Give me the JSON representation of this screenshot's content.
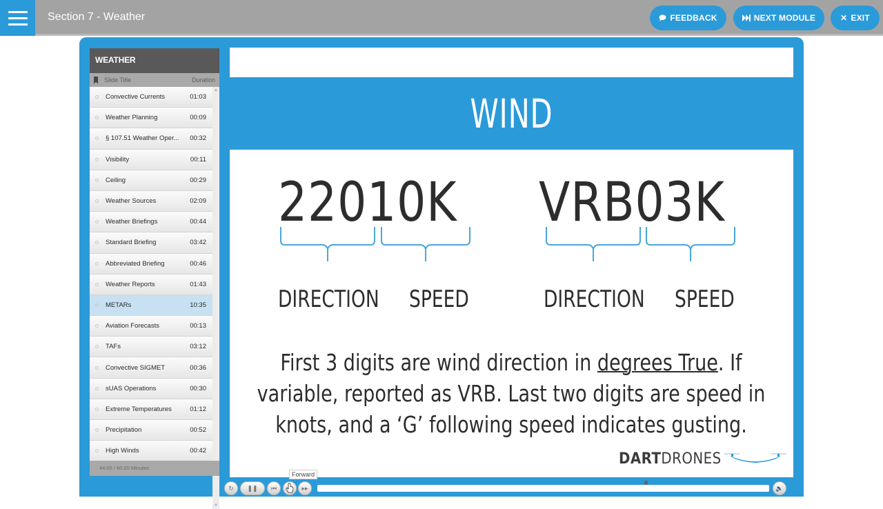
{
  "topbar": {
    "title": "Section 7 - Weather",
    "progress_fraction": 0.04,
    "buttons": {
      "feedback": {
        "icon": "speech-bubble-icon",
        "label": "FEEDBACK"
      },
      "next_module": {
        "icon": "skip-forward-icon",
        "label": "NEXT MODULE"
      },
      "exit": {
        "icon": "close-icon",
        "label": "EXIT"
      }
    },
    "accent_color": "#2b9ad9"
  },
  "outline": {
    "heading": "WEATHER",
    "col_title": "Slide Title",
    "col_duration": "Duration",
    "items": [
      {
        "title": "Convective Currents",
        "duration": "01:03"
      },
      {
        "title": "Weather Planning",
        "duration": "00:09"
      },
      {
        "title": "§ 107.51 Weather Oper...",
        "duration": "00:32"
      },
      {
        "title": "Visibility",
        "duration": "00:11"
      },
      {
        "title": "Ceiling",
        "duration": "00:29"
      },
      {
        "title": "Weather Sources",
        "duration": "02:09"
      },
      {
        "title": "Weather Briefings",
        "duration": "00:44"
      },
      {
        "title": "Standard Briefing",
        "duration": "03:42"
      },
      {
        "title": "Abbreviated Briefing",
        "duration": "00:46"
      },
      {
        "title": "Weather Reports",
        "duration": "01:43"
      },
      {
        "title": "METARs",
        "duration": "10:35",
        "active": true
      },
      {
        "title": "Aviation Forecasts",
        "duration": "00:13"
      },
      {
        "title": "TAFs",
        "duration": "03:12"
      },
      {
        "title": "Convective SIGMET",
        "duration": "00:36"
      },
      {
        "title": "sUAS Operations",
        "duration": "00:30"
      },
      {
        "title": "Extreme Temperatures",
        "duration": "01:12"
      },
      {
        "title": "Precipitation",
        "duration": "00:52"
      },
      {
        "title": "High Winds",
        "duration": "00:42"
      }
    ],
    "footer": "44:05 / 60:20 Minutes"
  },
  "slide": {
    "title": "WIND",
    "example1": {
      "code": "22010K",
      "label_direction": "DIRECTION",
      "label_speed": "SPEED"
    },
    "example2": {
      "code": "VRB03K",
      "label_direction": "DIRECTION",
      "label_speed": "SPEED"
    },
    "description": {
      "before": "First 3 digits are wind direction in ",
      "underlined": "degrees True",
      "after": ".  If variable, reported as VRB.  Last two digits are speed in knots, and a ‘G’ following speed indicates gusting."
    },
    "logo": {
      "bold": "DART",
      "regular": "DRONES"
    }
  },
  "player": {
    "tooltip": "Forward",
    "seek_fraction": 0.727,
    "controls": {
      "replay": "replay-icon",
      "pause": "pause-icon",
      "prev": "previous-icon",
      "next": "next-icon",
      "forward": "fast-forward-icon",
      "volume": "volume-icon"
    }
  }
}
